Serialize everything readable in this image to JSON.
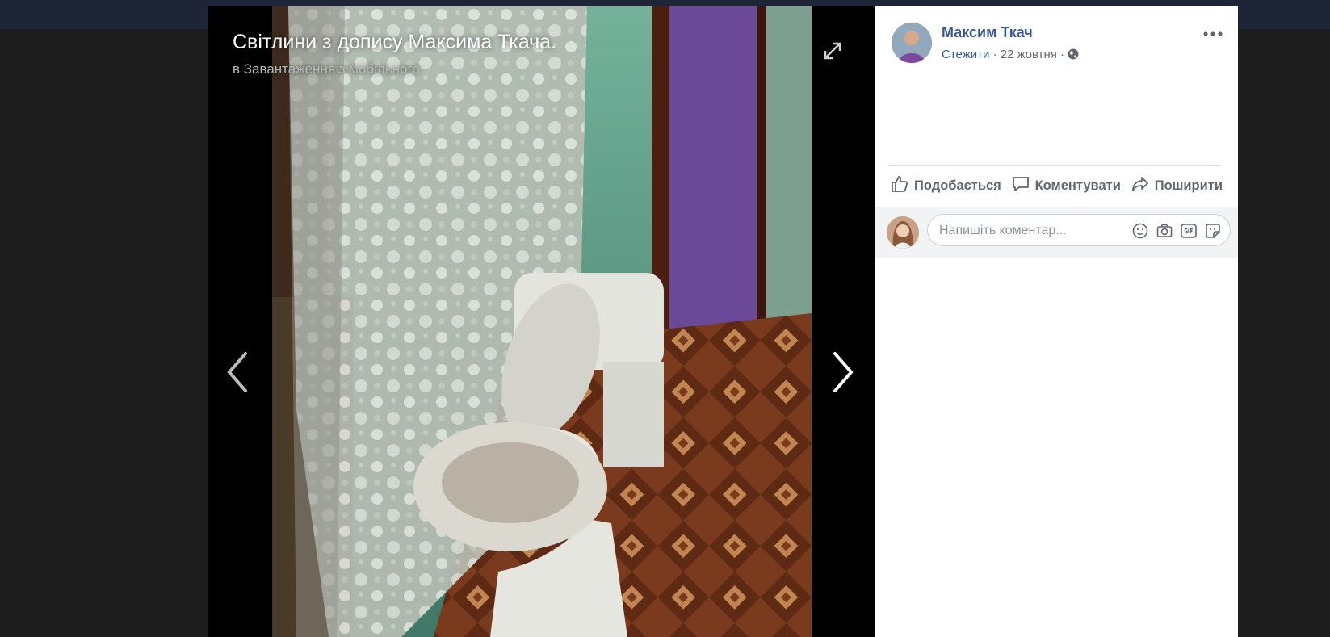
{
  "photo": {
    "title": "Світлини з допису Максима Ткача.",
    "album": "в Завантаження з мобільного"
  },
  "post": {
    "author": "Максим Ткач",
    "follow_label": "Стежити",
    "date": "22 жовтня",
    "separator": "·"
  },
  "actions": {
    "like": "Подобається",
    "comment": "Коментувати",
    "share": "Поширити"
  },
  "comment_box": {
    "placeholder": "Напишіть коментар..."
  },
  "colors": {
    "link": "#385898",
    "action_text": "#606770",
    "viewer_bg": "#000000"
  },
  "icons": [
    "expand-icon",
    "chevron-left-icon",
    "chevron-right-icon",
    "more-options-icon",
    "globe-icon",
    "like-icon",
    "comment-icon",
    "share-icon",
    "emoji-icon",
    "camera-icon",
    "gif-icon",
    "sticker-icon"
  ]
}
